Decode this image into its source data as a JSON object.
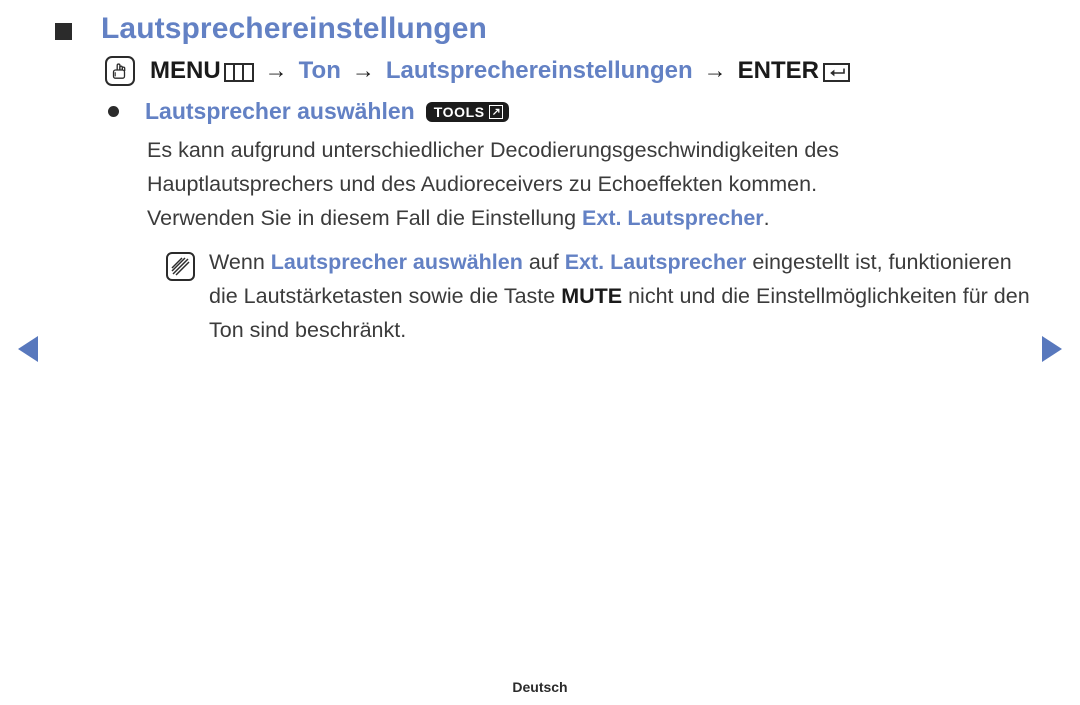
{
  "page": {
    "title": "Lautsprechereinstellungen",
    "footer_language": "Deutsch"
  },
  "menu_path": {
    "touch_icon": "touch-hand-icon",
    "menu_label": "MENU",
    "menu_glyph": "menu-columns-icon",
    "separator": "→",
    "segment_ton": "Ton",
    "segment_speaker_settings": "Lautsprechereinstellungen",
    "enter_label": "ENTER",
    "enter_glyph": "enter-return-icon"
  },
  "subheading": {
    "label": "Lautsprecher auswählen",
    "badge_label": "TOOLS",
    "badge_icon": "tools-arrow-icon"
  },
  "body": {
    "line1": "Es kann aufgrund unterschiedlicher Decodierungsgeschwindigkeiten des",
    "line2": "Hauptlautsprechers und des Audioreceivers zu Echoeffekten kommen.",
    "line3_prefix": "Verwenden Sie in diesem Fall die Einstellung ",
    "line3_keyword": "Ext. Lautsprecher",
    "line3_suffix": "."
  },
  "note": {
    "icon": "note-pencil-icon",
    "part1": "Wenn ",
    "keyword1": "Lautsprecher auswählen",
    "part2": " auf ",
    "keyword2": "Ext. Lautsprecher",
    "part3": " eingestellt ist, funktionieren die Lautstärketasten sowie die Taste ",
    "keyword3": "MUTE",
    "part4": " nicht und die Einstellmöglichkeiten für den Ton sind beschränkt."
  },
  "navigation": {
    "prev_label": "◀",
    "next_label": "▶"
  },
  "colors": {
    "accent_blue": "#6381c4",
    "nav_blue": "#5878bd",
    "text_dark": "#3b3b3b",
    "badge_black": "#1c1c1c"
  }
}
